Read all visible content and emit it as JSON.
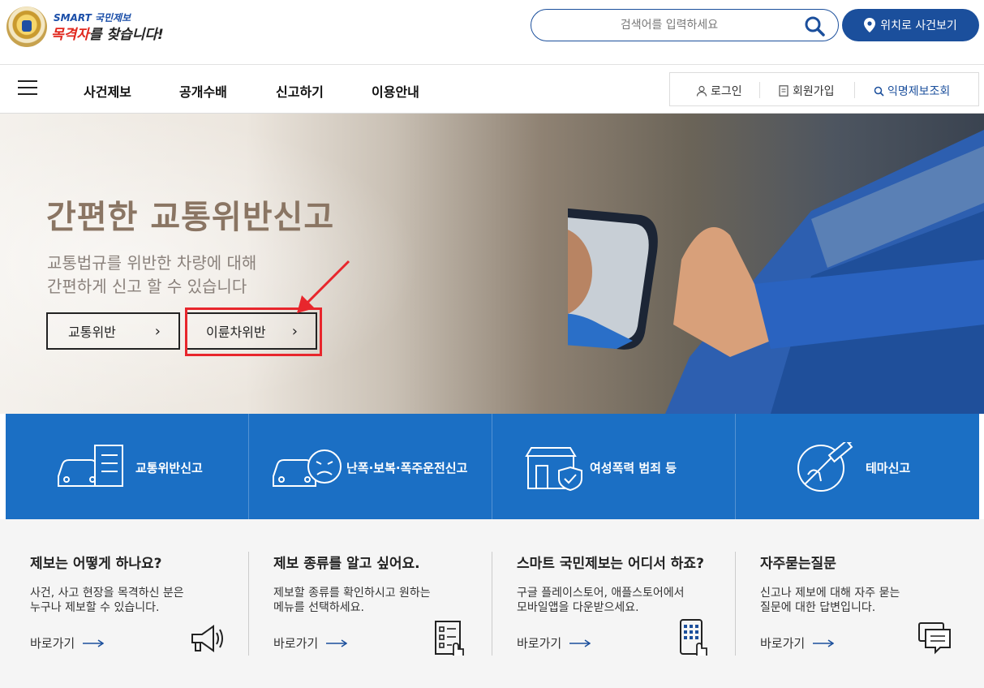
{
  "header": {
    "logo_smart": "SMART 국민제보",
    "logo_main_red": "목격자",
    "logo_main_rest": "를 찾습니다!",
    "search_placeholder": "검색어를 입력하세요",
    "location_button": "위치로 사건보기"
  },
  "nav": {
    "items": [
      "사건제보",
      "공개수배",
      "신고하기",
      "이용안내"
    ],
    "util": [
      "로그인",
      "회원가입",
      "익명제보조회"
    ]
  },
  "hero": {
    "title": "간편한 교통위반신고",
    "subtitle_line1": "교통법규를 위반한 차량에 대해",
    "subtitle_line2": "간편하게 신고 할 수 있습니다",
    "buttons": [
      "교통위반",
      "이륜차위반"
    ]
  },
  "features": [
    {
      "label": "교통위반신고",
      "icon": "car-document-icon"
    },
    {
      "label": "난폭·보복·폭주운전신고",
      "icon": "car-angry-face-icon"
    },
    {
      "label": "여성폭력 범죄 등",
      "icon": "store-shield-icon"
    },
    {
      "label": "테마신고",
      "icon": "syringe-hand-icon"
    }
  ],
  "info": [
    {
      "title": "제보는 어떻게 하나요?",
      "desc1": "사건, 사고 현장을 목격하신 분은",
      "desc2": "누구나 제보할 수 있습니다.",
      "link": "바로가기",
      "icon": "megaphone-icon"
    },
    {
      "title": "제보 종류를 알고 싶어요.",
      "desc1": "제보할 종류를 확인하시고 원하는",
      "desc2": "메뉴를 선택하세요.",
      "link": "바로가기",
      "icon": "checklist-icon"
    },
    {
      "title": "스마트 국민제보는 어디서 하죠?",
      "desc1": "구글 플레이스토어, 애플스토어에서",
      "desc2": "모바일앱을 다운받으세요.",
      "link": "바로가기",
      "icon": "smartphone-icon"
    },
    {
      "title": "자주묻는질문",
      "desc1": "신고나 제보에 대해 자주 묻는",
      "desc2": "질문에 대한 답변입니다.",
      "link": "바로가기",
      "icon": "chat-bubble-icon"
    }
  ],
  "colors": {
    "brand_blue": "#1b4f9c",
    "tile_blue": "#1b6fc4",
    "highlight_red": "#e8262c"
  }
}
